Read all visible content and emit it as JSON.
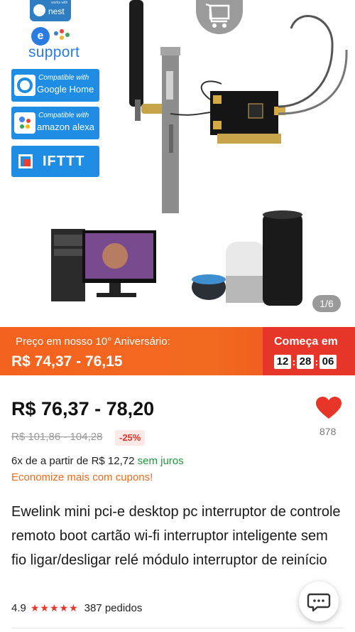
{
  "hero": {
    "badges": {
      "nest": "nest",
      "nest_small": "works with",
      "esupport": "support",
      "esupport_letter": "e",
      "google_small": "Compatible with",
      "google_big": "Google Home",
      "alexa_small": "Compatible with",
      "alexa_big": "amazon alexa",
      "ifttt": "IFTTT"
    },
    "counter": "1/6",
    "icons": [
      "back-icon",
      "cart-icon",
      "share-icon",
      "more-icon"
    ]
  },
  "promo": {
    "label": "Preço em nosso 10° Aniversário:",
    "price": "R$ 74,37 - 76,15",
    "starts_label": "Começa em",
    "timer": {
      "h": "12",
      "m": "28",
      "s": "06"
    },
    "colors": {
      "orange": "#f4621f",
      "red": "#e8352a"
    }
  },
  "product": {
    "price": "R$ 76,37 - 78,20",
    "old_price": "R$ 101,86 - 104,28",
    "discount": "-25%",
    "favorites": "878",
    "installments_text": "6x de a partir de R$ 12,72",
    "installments_green": "sem juros",
    "coupon": "Economize mais com cupons!",
    "title": "Ewelink mini pci-e desktop pc interruptor de controle remoto boot cartão wi-fi interruptor inteligente sem fio ligar/desligar relé módulo interruptor de reinício",
    "rating": "4.9",
    "stars": "★★★★★",
    "orders": "387 pedidos"
  }
}
